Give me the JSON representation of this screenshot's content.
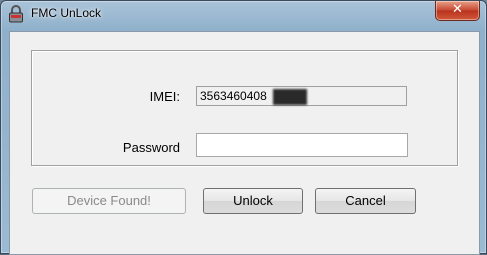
{
  "window": {
    "title": "FMC UnLock",
    "app_icon": "lock-icon",
    "close_glyph": "✕"
  },
  "form": {
    "imei_label": "IMEI:",
    "imei_value": "3563460408",
    "password_label": "Password",
    "password_value": ""
  },
  "buttons": {
    "device_found": "Device Found!",
    "unlock": "Unlock",
    "cancel": "Cancel"
  },
  "colors": {
    "close_button": "#c7462f",
    "dialog_background": "#f0f0f0"
  }
}
